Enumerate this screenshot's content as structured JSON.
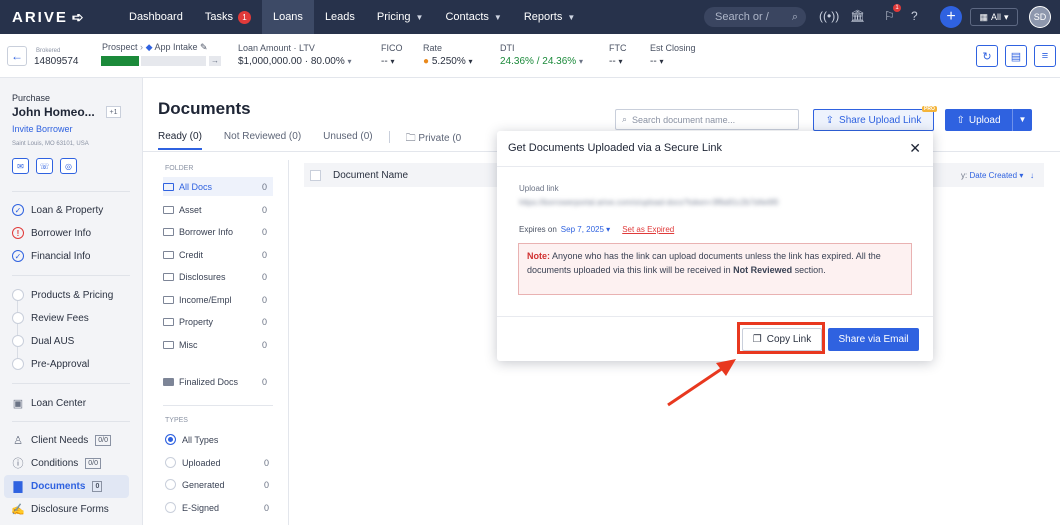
{
  "nav": {
    "logo": "ARIVE",
    "items": [
      "Dashboard",
      "Tasks",
      "Loans",
      "Leads",
      "Pricing",
      "Contacts",
      "Reports"
    ],
    "tasks_badge": "1",
    "search_placeholder": "Search or /",
    "notif_badge": "1",
    "all_label": "All",
    "avatar": "SD"
  },
  "loan": {
    "status_small": "Brokered",
    "loan_id": "14809574",
    "stage_prev": "Prospect",
    "stage_next": "App Intake",
    "amount_label": "Loan Amount · LTV",
    "amount": "$1,000,000.00",
    "ltv": "80.00%",
    "fico_label": "FICO",
    "fico": "--",
    "rate_label": "Rate",
    "rate": "5.250%",
    "dti_label": "DTI",
    "dti_front": "24.36%",
    "dti_back": "24.36%",
    "ftc_label": "FTC",
    "ftc": "--",
    "closing_label": "Est Closing",
    "closing": "--"
  },
  "sidebar": {
    "loan_purpose": "Purchase",
    "borrower_name": "John Homeo...",
    "plus_count": "+1",
    "invite": "Invite Borrower",
    "address": "Saint Louis, MO 63101, USA",
    "group1": [
      "Loan & Property",
      "Borrower Info",
      "Financial Info"
    ],
    "group2": [
      "Products & Pricing",
      "Review Fees",
      "Dual AUS",
      "Pre-Approval"
    ],
    "loan_center": "Loan Center",
    "client_needs": "Client Needs",
    "client_needs_count": "0/0",
    "conditions": "Conditions",
    "conditions_count": "0/0",
    "documents": "Documents",
    "documents_count": "0",
    "disclosure_forms": "Disclosure Forms"
  },
  "main": {
    "title": "Documents",
    "tabs": [
      "Ready (0)",
      "Not Reviewed (0)",
      "Unused (0)",
      "Private (0"
    ],
    "search_placeholder": "Search document name...",
    "share_upload": "Share Upload Link",
    "pro": "PRO",
    "upload": "Upload",
    "folder_label": "FOLDER",
    "folders": [
      {
        "name": "All Docs",
        "count": "0"
      },
      {
        "name": "Asset",
        "count": "0"
      },
      {
        "name": "Borrower Info",
        "count": "0"
      },
      {
        "name": "Credit",
        "count": "0"
      },
      {
        "name": "Disclosures",
        "count": "0"
      },
      {
        "name": "Income/Empl",
        "count": "0"
      },
      {
        "name": "Property",
        "count": "0"
      },
      {
        "name": "Misc",
        "count": "0"
      }
    ],
    "finalized": {
      "name": "Finalized Docs",
      "count": "0"
    },
    "types_label": "TYPES",
    "types": [
      {
        "name": "All Types",
        "count": ""
      },
      {
        "name": "Uploaded",
        "count": "0"
      },
      {
        "name": "Generated",
        "count": "0"
      },
      {
        "name": "E-Signed",
        "count": "0"
      }
    ],
    "col_doc_name": "Document Name",
    "sort_label": "y:",
    "sort_value": "Date Created"
  },
  "modal": {
    "title": "Get Documents Uploaded via a Secure Link",
    "upload_link_label": "Upload link",
    "link_value": "https://borrowerportal.arive.com/s/upload-docs?token=3f8a91c2b7d4e6f0",
    "expires_label": "Expires on",
    "expires_date": "Sep 7, 2025",
    "set_expired": "Set as Expired",
    "note_prefix": "Note:",
    "note_text": "Anyone who has the link can upload documents unless the link has expired. All the documents uploaded via this link will be received in",
    "note_bold": "Not Reviewed",
    "note_suffix": "section.",
    "copy_link": "Copy Link",
    "share_email": "Share via Email"
  },
  "colors": {
    "accent": "#2f62e0",
    "nav_bg": "#27324b",
    "highlight": "#e8381f",
    "success": "#1b8a3a"
  }
}
